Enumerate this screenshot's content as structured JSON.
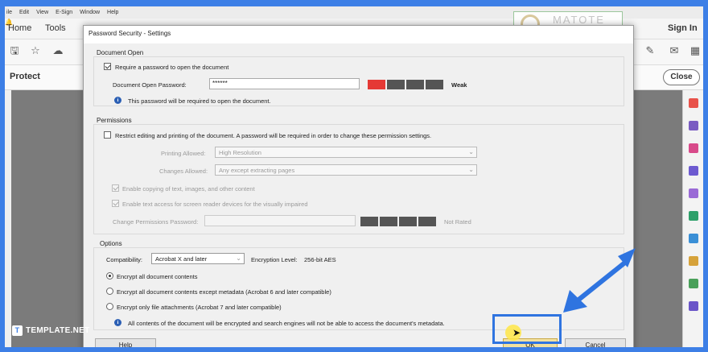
{
  "app": {
    "menu": [
      "ile",
      "Edit",
      "View",
      "E-Sign",
      "Window",
      "Help"
    ],
    "nav": {
      "home": "Home",
      "tools": "Tools",
      "sign_in": "Sign In"
    },
    "protect_title": "Protect",
    "close_label": "Close",
    "watermark_text": "MATOTE"
  },
  "dialog": {
    "title": "Password Security - Settings",
    "document_open": {
      "group_label": "Document Open",
      "require_label": "Require a password to open the document",
      "require_checked": true,
      "password_label": "Document Open Password:",
      "password_value": "******",
      "strength_label": "Weak",
      "info_text": "This password will be required to open the document."
    },
    "permissions": {
      "group_label": "Permissions",
      "restrict_label": "Restrict editing and printing of the document. A password will be required in order to change these permission settings.",
      "restrict_checked": false,
      "printing_label": "Printing Allowed:",
      "printing_value": "High Resolution",
      "changes_label": "Changes Allowed:",
      "changes_value": "Any except extracting pages",
      "copy_label": "Enable copying of text, images, and other content",
      "copy_checked": true,
      "access_label": "Enable text access for screen reader devices for the visually impaired",
      "access_checked": true,
      "change_pw_label": "Change Permissions Password:",
      "change_pw_value": "",
      "rating_label": "Not Rated"
    },
    "options": {
      "group_label": "Options",
      "compat_label": "Compatibility:",
      "compat_value": "Acrobat X and later",
      "encryption_label": "Encryption  Level:",
      "encryption_value": "256-bit AES",
      "radio_all": "Encrypt all document contents",
      "radio_except": "Encrypt all document contents except metadata (Acrobat 6 and later compatible)",
      "radio_attach": "Encrypt only file attachments (Acrobat 7 and later compatible)",
      "selected": "all",
      "info_text": "All contents of the document will be encrypted and search engines will not be able to access the document's metadata."
    },
    "buttons": {
      "help": "Help",
      "ok": "OK",
      "cancel": "Cancel"
    }
  },
  "brand": {
    "logo": "T",
    "name": "TEMPLATE.NET"
  },
  "colors": {
    "frame": "#3d7fe6",
    "highlight": "#2f74e0",
    "strength_weak": "#e53935",
    "strength_empty": "#555555"
  },
  "icons": [
    "save-icon",
    "star-icon",
    "cloud-upload-icon",
    "bell-icon",
    "sign-icon",
    "mail-icon",
    "apps-grid-icon",
    "info-icon",
    "cursor-icon",
    "arrow-icon"
  ]
}
